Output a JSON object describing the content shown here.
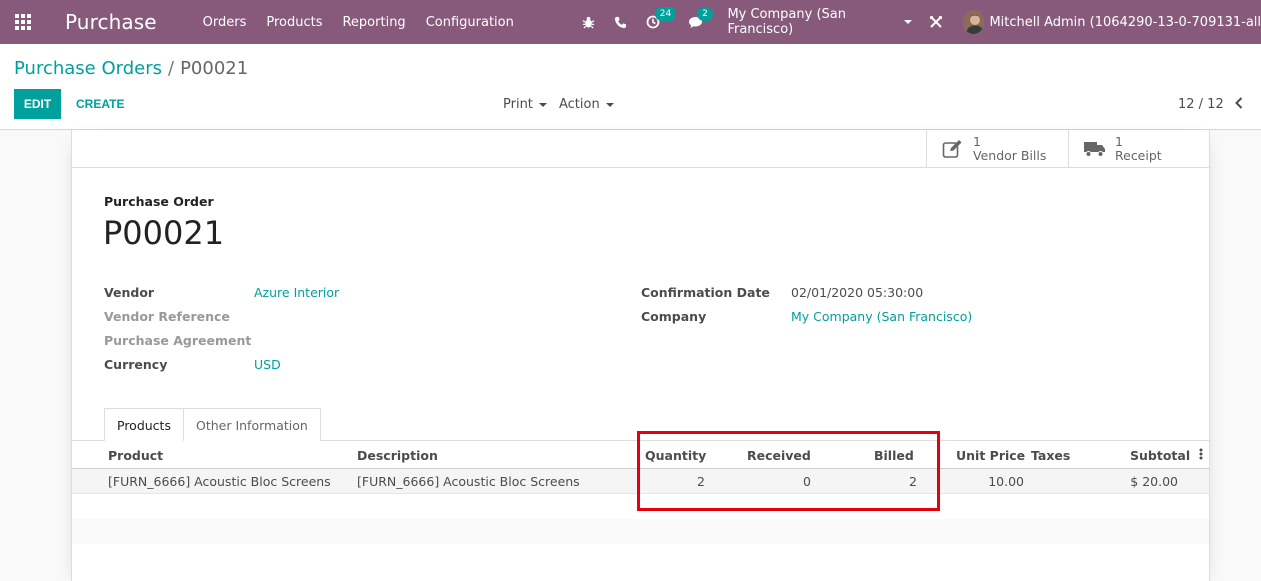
{
  "navbar": {
    "app_title": "Purchase",
    "menu": [
      "Orders",
      "Products",
      "Reporting",
      "Configuration"
    ],
    "activity_count": "24",
    "message_count": "2",
    "company": "My Company (San Francisco)",
    "user": "Mitchell Admin (1064290-13-0-709131-all"
  },
  "control": {
    "breadcrumb_parent": "Purchase Orders",
    "breadcrumb_sep": "/",
    "breadcrumb_current": "P00021",
    "edit_label": "EDIT",
    "create_label": "CREATE",
    "print_label": "Print",
    "action_label": "Action",
    "pager": "12 / 12"
  },
  "smart_buttons": {
    "vendor_bills_count": "1",
    "vendor_bills_label": "Vendor Bills",
    "receipt_count": "1",
    "receipt_label": "Receipt"
  },
  "form": {
    "doc_label": "Purchase Order",
    "doc_name": "P00021",
    "vendor_label": "Vendor",
    "vendor_value": "Azure Interior",
    "vendor_ref_label": "Vendor Reference",
    "agreement_label": "Purchase Agreement",
    "currency_label": "Currency",
    "currency_value": "USD",
    "confirmation_label": "Confirmation Date",
    "confirmation_value": "02/01/2020 05:30:00",
    "company_label": "Company",
    "company_value": "My Company (San Francisco)"
  },
  "tabs": [
    "Products",
    "Other Information"
  ],
  "table": {
    "headers": {
      "product": "Product",
      "description": "Description",
      "quantity": "Quantity",
      "received": "Received",
      "billed": "Billed",
      "unit_price": "Unit Price",
      "taxes": "Taxes",
      "subtotal": "Subtotal"
    },
    "rows": [
      {
        "product": "[FURN_6666] Acoustic Bloc Screens",
        "description": "[FURN_6666] Acoustic Bloc Screens",
        "quantity": "2",
        "received": "0",
        "billed": "2",
        "unit_price": "10.00",
        "taxes": "",
        "subtotal": "$ 20.00"
      }
    ]
  },
  "colors": {
    "navbar": "#875a7b",
    "accent": "#00a09d",
    "highlight": "#e3000f"
  }
}
